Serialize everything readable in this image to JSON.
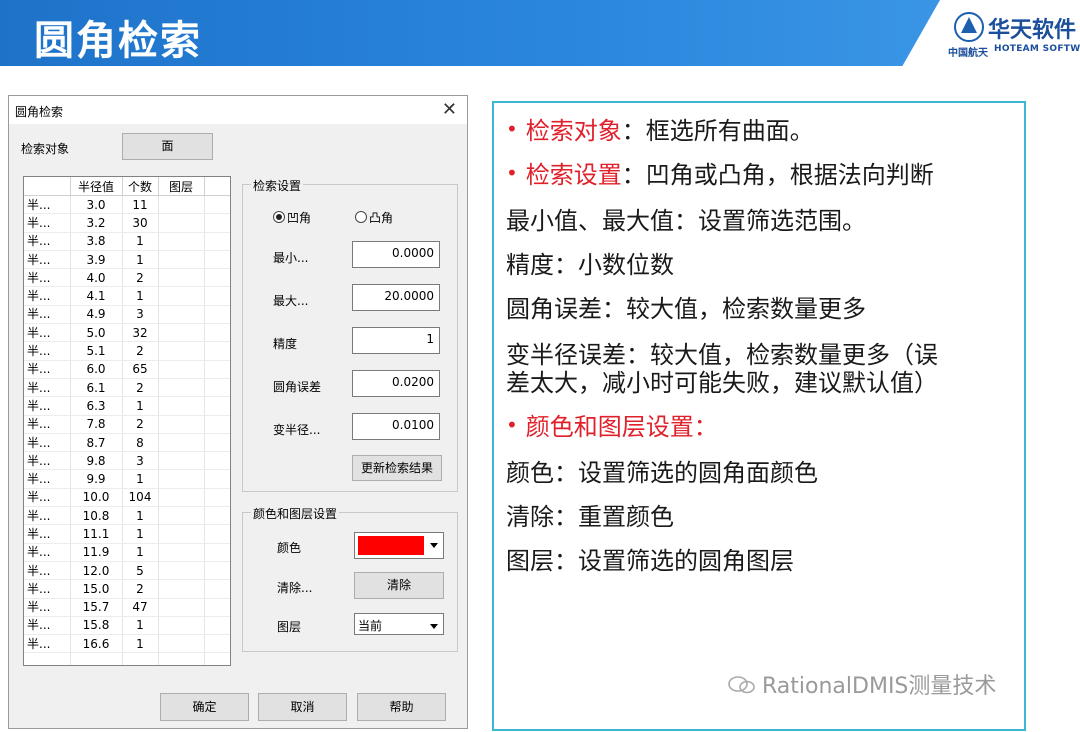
{
  "slide": {
    "title": "圆角检索",
    "logo": {
      "name": "华天软件",
      "sub_cn": "中国航天",
      "sub_en": "HOTEAM SOFTWARE"
    }
  },
  "dialog": {
    "title": "圆角检索",
    "search_object_label": "检索对象",
    "search_object_button": "面",
    "table": {
      "headers": [
        "",
        "半径值",
        "个数",
        "图层"
      ],
      "rows": [
        [
          "半...",
          "3.0",
          "11"
        ],
        [
          "半...",
          "3.2",
          "30"
        ],
        [
          "半...",
          "3.8",
          "1"
        ],
        [
          "半...",
          "3.9",
          "1"
        ],
        [
          "半...",
          "4.0",
          "2"
        ],
        [
          "半...",
          "4.1",
          "1"
        ],
        [
          "半...",
          "4.9",
          "3"
        ],
        [
          "半...",
          "5.0",
          "32"
        ],
        [
          "半...",
          "5.1",
          "2"
        ],
        [
          "半...",
          "6.0",
          "65"
        ],
        [
          "半...",
          "6.1",
          "2"
        ],
        [
          "半...",
          "6.3",
          "1"
        ],
        [
          "半...",
          "7.8",
          "2"
        ],
        [
          "半...",
          "8.7",
          "8"
        ],
        [
          "半...",
          "9.8",
          "3"
        ],
        [
          "半...",
          "9.9",
          "1"
        ],
        [
          "半...",
          "10.0",
          "104"
        ],
        [
          "半...",
          "10.8",
          "1"
        ],
        [
          "半...",
          "11.1",
          "1"
        ],
        [
          "半...",
          "11.9",
          "1"
        ],
        [
          "半...",
          "12.0",
          "5"
        ],
        [
          "半...",
          "15.0",
          "2"
        ],
        [
          "半...",
          "15.7",
          "47"
        ],
        [
          "半...",
          "15.8",
          "1"
        ],
        [
          "半...",
          "16.6",
          "1"
        ]
      ]
    },
    "search_settings": {
      "title": "检索设置",
      "concave_label": "凹角",
      "convex_label": "凸角",
      "selected": "concave",
      "min_label": "最小...",
      "min_value": "0.0000",
      "max_label": "最大...",
      "max_value": "20.0000",
      "precision_label": "精度",
      "precision_value": "1",
      "fillet_error_label": "圆角误差",
      "fillet_error_value": "0.0200",
      "var_radius_label": "变半径...",
      "var_radius_value": "0.0100",
      "update_button": "更新检索结果"
    },
    "color_layer": {
      "title": "颜色和图层设置",
      "color_label": "颜色",
      "color_value": "#ff0000",
      "clear_label": "清除...",
      "clear_button": "清除",
      "layer_label": "图层",
      "layer_value": "当前"
    },
    "buttons": {
      "ok": "确定",
      "cancel": "取消",
      "help": "帮助"
    }
  },
  "notes": {
    "line1_red": "检索对象",
    "line1_rest": "：框选所有曲面。",
    "line2_red": "检索设置",
    "line2_rest": "：凹角或凸角，根据法向判断",
    "line3": "最小值、最大值：设置筛选范围。",
    "line4": "精度：小数位数",
    "line5": "圆角误差：较大值，检索数量更多",
    "line6a": "变半径误差：较大值，检索数量更多（误",
    "line6b": "差太大，减小时可能失败，建议默认值）",
    "line7_red": "颜色和图层设置：",
    "line8": "颜色：设置筛选的圆角面颜色",
    "line9": "清除：重置颜色",
    "line10": "图层：设置筛选的圆角图层",
    "bullet": "•"
  },
  "watermark": "RationalDMIS测量技术",
  "colors": {
    "banner": "#1e73c9",
    "panel_border": "#3bb7d3",
    "accent_red": "#e0202a"
  }
}
